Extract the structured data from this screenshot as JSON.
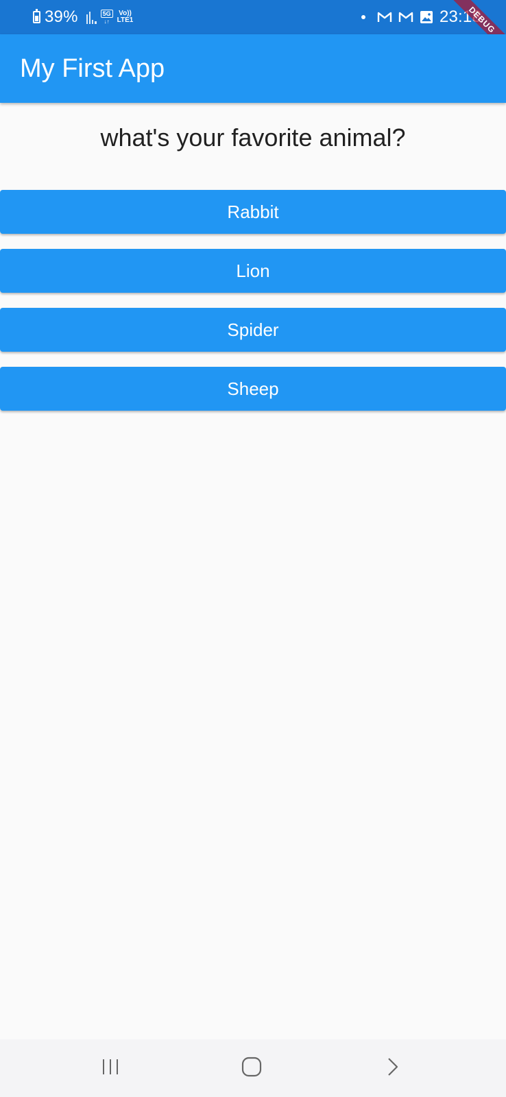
{
  "status_bar": {
    "battery_percent": "39%",
    "network_5g": "5G",
    "volte_top": "Vo))",
    "volte_bottom": "LTE1",
    "time": "23:18",
    "icons": [
      "battery-icon",
      "signal-icon",
      "5g-icon",
      "volte-icon",
      "notification-dot-icon",
      "gmail-icon",
      "gmail-icon",
      "photo-icon"
    ]
  },
  "debug_banner": {
    "label": "DEBUG"
  },
  "app_bar": {
    "title": "My First App",
    "color": "#2196f3"
  },
  "quiz": {
    "question": "what's your favorite animal?",
    "answers": [
      {
        "label": "Rabbit"
      },
      {
        "label": "Lion"
      },
      {
        "label": "Spider"
      },
      {
        "label": "Sheep"
      }
    ]
  },
  "nav_bar": {
    "icons": [
      "recents-icon",
      "home-icon",
      "back-icon"
    ]
  },
  "colors": {
    "status_bar": "#1976d2",
    "primary": "#2196f3",
    "background": "#fafafa",
    "text": "#212121"
  }
}
